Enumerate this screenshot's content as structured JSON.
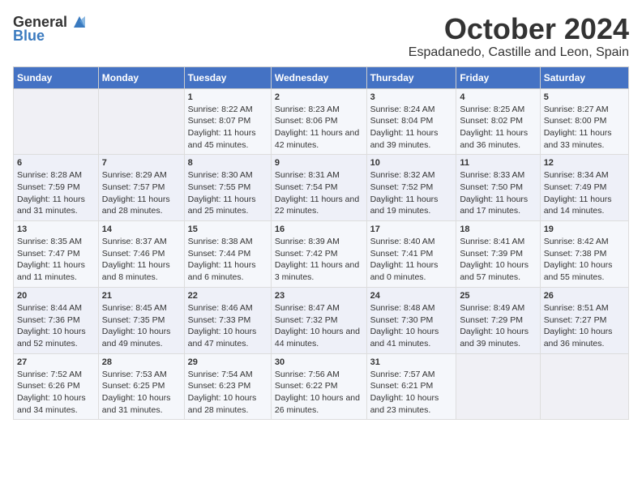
{
  "logo": {
    "general": "General",
    "blue": "Blue"
  },
  "title": {
    "month": "October 2024",
    "location": "Espadanedo, Castille and Leon, Spain"
  },
  "headers": [
    "Sunday",
    "Monday",
    "Tuesday",
    "Wednesday",
    "Thursday",
    "Friday",
    "Saturday"
  ],
  "weeks": [
    [
      {
        "day": "",
        "sunrise": "",
        "sunset": "",
        "daylight": ""
      },
      {
        "day": "",
        "sunrise": "",
        "sunset": "",
        "daylight": ""
      },
      {
        "day": "1",
        "sunrise": "Sunrise: 8:22 AM",
        "sunset": "Sunset: 8:07 PM",
        "daylight": "Daylight: 11 hours and 45 minutes."
      },
      {
        "day": "2",
        "sunrise": "Sunrise: 8:23 AM",
        "sunset": "Sunset: 8:06 PM",
        "daylight": "Daylight: 11 hours and 42 minutes."
      },
      {
        "day": "3",
        "sunrise": "Sunrise: 8:24 AM",
        "sunset": "Sunset: 8:04 PM",
        "daylight": "Daylight: 11 hours and 39 minutes."
      },
      {
        "day": "4",
        "sunrise": "Sunrise: 8:25 AM",
        "sunset": "Sunset: 8:02 PM",
        "daylight": "Daylight: 11 hours and 36 minutes."
      },
      {
        "day": "5",
        "sunrise": "Sunrise: 8:27 AM",
        "sunset": "Sunset: 8:00 PM",
        "daylight": "Daylight: 11 hours and 33 minutes."
      }
    ],
    [
      {
        "day": "6",
        "sunrise": "Sunrise: 8:28 AM",
        "sunset": "Sunset: 7:59 PM",
        "daylight": "Daylight: 11 hours and 31 minutes."
      },
      {
        "day": "7",
        "sunrise": "Sunrise: 8:29 AM",
        "sunset": "Sunset: 7:57 PM",
        "daylight": "Daylight: 11 hours and 28 minutes."
      },
      {
        "day": "8",
        "sunrise": "Sunrise: 8:30 AM",
        "sunset": "Sunset: 7:55 PM",
        "daylight": "Daylight: 11 hours and 25 minutes."
      },
      {
        "day": "9",
        "sunrise": "Sunrise: 8:31 AM",
        "sunset": "Sunset: 7:54 PM",
        "daylight": "Daylight: 11 hours and 22 minutes."
      },
      {
        "day": "10",
        "sunrise": "Sunrise: 8:32 AM",
        "sunset": "Sunset: 7:52 PM",
        "daylight": "Daylight: 11 hours and 19 minutes."
      },
      {
        "day": "11",
        "sunrise": "Sunrise: 8:33 AM",
        "sunset": "Sunset: 7:50 PM",
        "daylight": "Daylight: 11 hours and 17 minutes."
      },
      {
        "day": "12",
        "sunrise": "Sunrise: 8:34 AM",
        "sunset": "Sunset: 7:49 PM",
        "daylight": "Daylight: 11 hours and 14 minutes."
      }
    ],
    [
      {
        "day": "13",
        "sunrise": "Sunrise: 8:35 AM",
        "sunset": "Sunset: 7:47 PM",
        "daylight": "Daylight: 11 hours and 11 minutes."
      },
      {
        "day": "14",
        "sunrise": "Sunrise: 8:37 AM",
        "sunset": "Sunset: 7:46 PM",
        "daylight": "Daylight: 11 hours and 8 minutes."
      },
      {
        "day": "15",
        "sunrise": "Sunrise: 8:38 AM",
        "sunset": "Sunset: 7:44 PM",
        "daylight": "Daylight: 11 hours and 6 minutes."
      },
      {
        "day": "16",
        "sunrise": "Sunrise: 8:39 AM",
        "sunset": "Sunset: 7:42 PM",
        "daylight": "Daylight: 11 hours and 3 minutes."
      },
      {
        "day": "17",
        "sunrise": "Sunrise: 8:40 AM",
        "sunset": "Sunset: 7:41 PM",
        "daylight": "Daylight: 11 hours and 0 minutes."
      },
      {
        "day": "18",
        "sunrise": "Sunrise: 8:41 AM",
        "sunset": "Sunset: 7:39 PM",
        "daylight": "Daylight: 10 hours and 57 minutes."
      },
      {
        "day": "19",
        "sunrise": "Sunrise: 8:42 AM",
        "sunset": "Sunset: 7:38 PM",
        "daylight": "Daylight: 10 hours and 55 minutes."
      }
    ],
    [
      {
        "day": "20",
        "sunrise": "Sunrise: 8:44 AM",
        "sunset": "Sunset: 7:36 PM",
        "daylight": "Daylight: 10 hours and 52 minutes."
      },
      {
        "day": "21",
        "sunrise": "Sunrise: 8:45 AM",
        "sunset": "Sunset: 7:35 PM",
        "daylight": "Daylight: 10 hours and 49 minutes."
      },
      {
        "day": "22",
        "sunrise": "Sunrise: 8:46 AM",
        "sunset": "Sunset: 7:33 PM",
        "daylight": "Daylight: 10 hours and 47 minutes."
      },
      {
        "day": "23",
        "sunrise": "Sunrise: 8:47 AM",
        "sunset": "Sunset: 7:32 PM",
        "daylight": "Daylight: 10 hours and 44 minutes."
      },
      {
        "day": "24",
        "sunrise": "Sunrise: 8:48 AM",
        "sunset": "Sunset: 7:30 PM",
        "daylight": "Daylight: 10 hours and 41 minutes."
      },
      {
        "day": "25",
        "sunrise": "Sunrise: 8:49 AM",
        "sunset": "Sunset: 7:29 PM",
        "daylight": "Daylight: 10 hours and 39 minutes."
      },
      {
        "day": "26",
        "sunrise": "Sunrise: 8:51 AM",
        "sunset": "Sunset: 7:27 PM",
        "daylight": "Daylight: 10 hours and 36 minutes."
      }
    ],
    [
      {
        "day": "27",
        "sunrise": "Sunrise: 7:52 AM",
        "sunset": "Sunset: 6:26 PM",
        "daylight": "Daylight: 10 hours and 34 minutes."
      },
      {
        "day": "28",
        "sunrise": "Sunrise: 7:53 AM",
        "sunset": "Sunset: 6:25 PM",
        "daylight": "Daylight: 10 hours and 31 minutes."
      },
      {
        "day": "29",
        "sunrise": "Sunrise: 7:54 AM",
        "sunset": "Sunset: 6:23 PM",
        "daylight": "Daylight: 10 hours and 28 minutes."
      },
      {
        "day": "30",
        "sunrise": "Sunrise: 7:56 AM",
        "sunset": "Sunset: 6:22 PM",
        "daylight": "Daylight: 10 hours and 26 minutes."
      },
      {
        "day": "31",
        "sunrise": "Sunrise: 7:57 AM",
        "sunset": "Sunset: 6:21 PM",
        "daylight": "Daylight: 10 hours and 23 minutes."
      },
      {
        "day": "",
        "sunrise": "",
        "sunset": "",
        "daylight": ""
      },
      {
        "day": "",
        "sunrise": "",
        "sunset": "",
        "daylight": ""
      }
    ]
  ]
}
